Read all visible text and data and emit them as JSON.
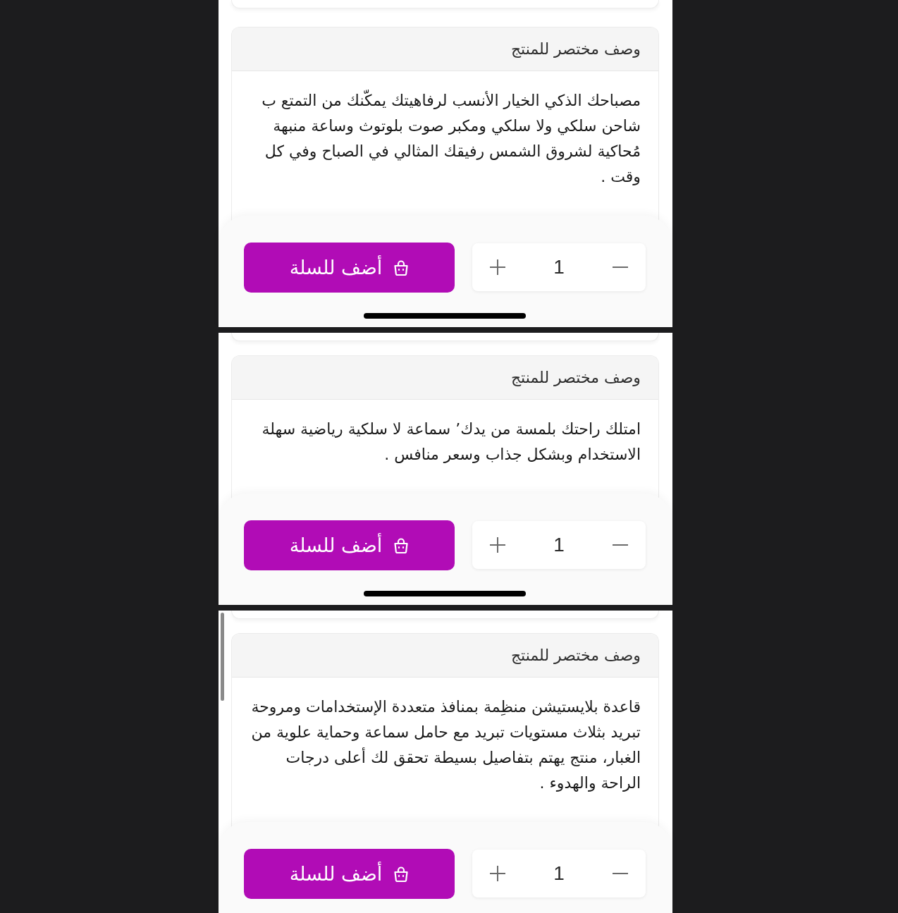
{
  "screenshots": [
    {
      "section_title": "وصف مختصر للمنتج",
      "description": "مصباحك الذكي الخيار الأنسب لرفاهيتك يمكّنك من التمتع ب شاحن سلكي ولا سلكي ومكبر صوت بلوتوث وساعة منبهة مُحاكية لشروق الشمس رفيقك المثالي في الصباح وفي كل وقت .",
      "quantity": "1",
      "add_to_cart": "أضف للسلة",
      "scrollbar": false
    },
    {
      "section_title": "وصف مختصر للمنتج",
      "description": "امتلك راحتك بلمسة من يدك’ سماعة لا سلكية رياضية سهلة الاستخدام وبشكل جذاب وسعر منافس .",
      "quantity": "1",
      "add_to_cart": "أضف للسلة",
      "scrollbar": false
    },
    {
      "section_title": "وصف مختصر للمنتج",
      "description": "قاعدة بلايستيشن منظِمة بمنافذ متعددة الإستخدامات ومروحة تبريد بثلاث مستويات تبريد مع حامل سماعة وحماية علوية من الغبار، منتج يهتم بتفاصيل بسيطة تحقق لك أعلى درجات الراحة والهدوء .",
      "quantity": "1",
      "add_to_cart": "أضف للسلة",
      "scrollbar": true
    }
  ]
}
